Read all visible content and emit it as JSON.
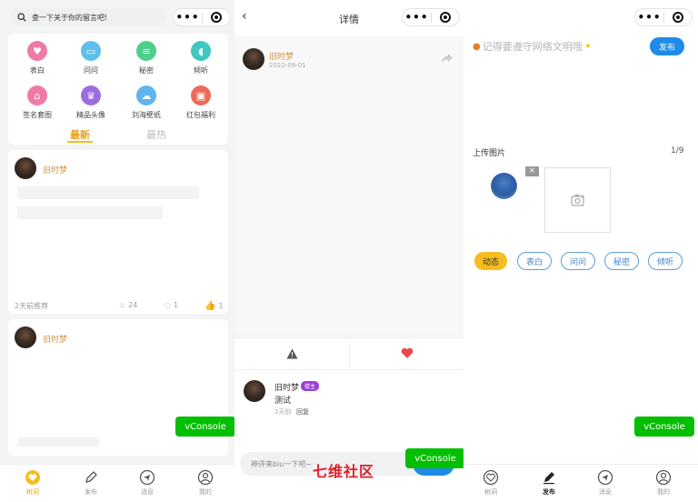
{
  "left": {
    "search_placeholder": "查一下关于你的留言吧!",
    "categories": [
      {
        "label": "表白",
        "color": "#f07aa6",
        "icon": "heart-icon"
      },
      {
        "label": "问问",
        "color": "#5cc0ea",
        "icon": "chat-icon"
      },
      {
        "label": "秘密",
        "color": "#4ecf8c",
        "icon": "note-icon"
      },
      {
        "label": "倾听",
        "color": "#3fc7c0",
        "icon": "ear-icon"
      },
      {
        "label": "签名套图",
        "color": "#f07aa6",
        "icon": "house-icon"
      },
      {
        "label": "精品头像",
        "color": "#9b6ee0",
        "icon": "crown-icon"
      },
      {
        "label": "刘海壁纸",
        "color": "#5fb4ee",
        "icon": "cloud-icon"
      },
      {
        "label": "红包福利",
        "color": "#ee6a58",
        "icon": "gift-icon"
      }
    ],
    "tabs": [
      "最新",
      "最热"
    ],
    "post1": {
      "user": "旧时梦",
      "time": "2天前推荐",
      "views": "24",
      "comments": "1",
      "likes": "1"
    },
    "post2": {
      "user": "旧时梦"
    },
    "nav": [
      "树洞",
      "发布",
      "消息",
      "我的"
    ]
  },
  "detail": {
    "title": "详情",
    "user": "旧时梦",
    "date": "2022-09-01",
    "comment": {
      "user": "旧时梦",
      "badge": "楼主",
      "text": "测试",
      "time": "2天前",
      "reply": "回复"
    },
    "input_placeholder": "神评来biu一下吧~",
    "watermark": "七维社区"
  },
  "publish": {
    "hint": "记得要遵守网络文明哦",
    "publish_label": "发布",
    "upload_label": "上传图片",
    "upload_count": "1/9",
    "close_symbol": "×",
    "tags": [
      "动态",
      "表白",
      "问问",
      "秘密",
      "倾听"
    ],
    "nav": [
      "树洞",
      "发布",
      "消息",
      "我的"
    ]
  },
  "vconsole_label": "vConsole",
  "colors": {
    "accent": "#f5bd1f",
    "primary": "#1e8be8",
    "vconsole": "#04be02",
    "username": "#d4923a"
  }
}
